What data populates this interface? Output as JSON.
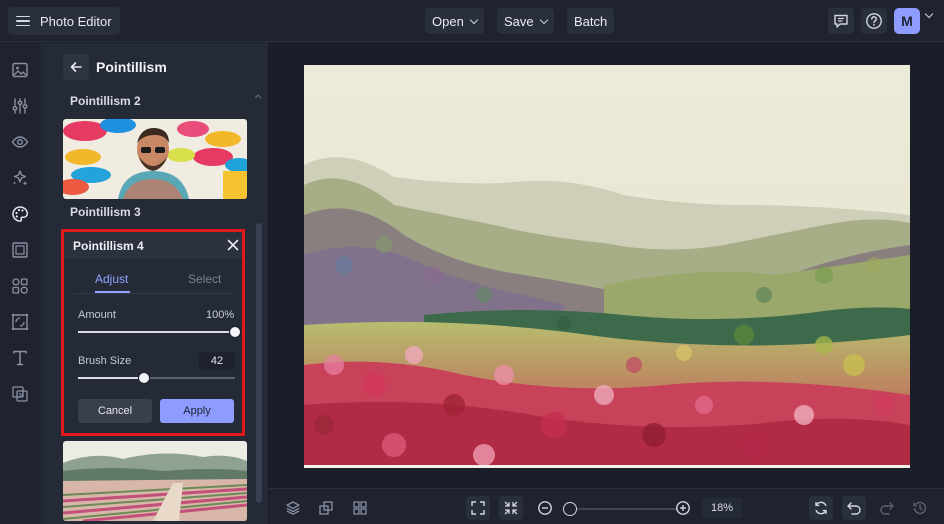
{
  "app": {
    "title": "Photo Editor"
  },
  "topbar": {
    "menus": [
      {
        "label": "Open",
        "has_chevron": true
      },
      {
        "label": "Save",
        "has_chevron": true
      },
      {
        "label": "Batch",
        "has_chevron": false
      }
    ],
    "icons": [
      "comments-icon",
      "help-icon"
    ],
    "avatar_initial": "M"
  },
  "rail": {
    "items": [
      "image-icon",
      "sliders-icon",
      "eye-icon",
      "sparkles-icon",
      "palette-icon",
      "frame-icon",
      "shapes-icon",
      "texture-icon",
      "text-icon",
      "overlay-icon"
    ],
    "active": "palette-icon"
  },
  "panel": {
    "title": "Pointillism",
    "effects": [
      {
        "label": "Pointillism 2"
      },
      {
        "label": "Pointillism 3"
      },
      {
        "label": "Pointillism 4"
      }
    ]
  },
  "settings": {
    "title": "Pointillism 4",
    "tabs": [
      {
        "label": "Adjust",
        "active": true
      },
      {
        "label": "Select",
        "active": false
      }
    ],
    "amount": {
      "label": "Amount",
      "value_text": "100%",
      "fraction": 1.0
    },
    "brush_size": {
      "label": "Brush Size",
      "value_text": "42",
      "fraction": 0.42
    },
    "cancel_label": "Cancel",
    "apply_label": "Apply"
  },
  "bottombar": {
    "left_icons": [
      "layers-icon",
      "arrange-icon",
      "grid-icon"
    ],
    "center_icons": [
      "fit-screen-icon",
      "shrink-icon",
      "zoom-out-icon",
      "zoom-in-icon"
    ],
    "zoom_text": "18%",
    "zoom_fraction": 0.0,
    "right_icons": [
      "reset-icon",
      "undo-icon",
      "redo-icon",
      "history-icon"
    ]
  },
  "colors": {
    "accent": "#8f9cff",
    "highlight_border": "#e01a1a",
    "background": "#1f2330",
    "panel": "#252a37"
  }
}
